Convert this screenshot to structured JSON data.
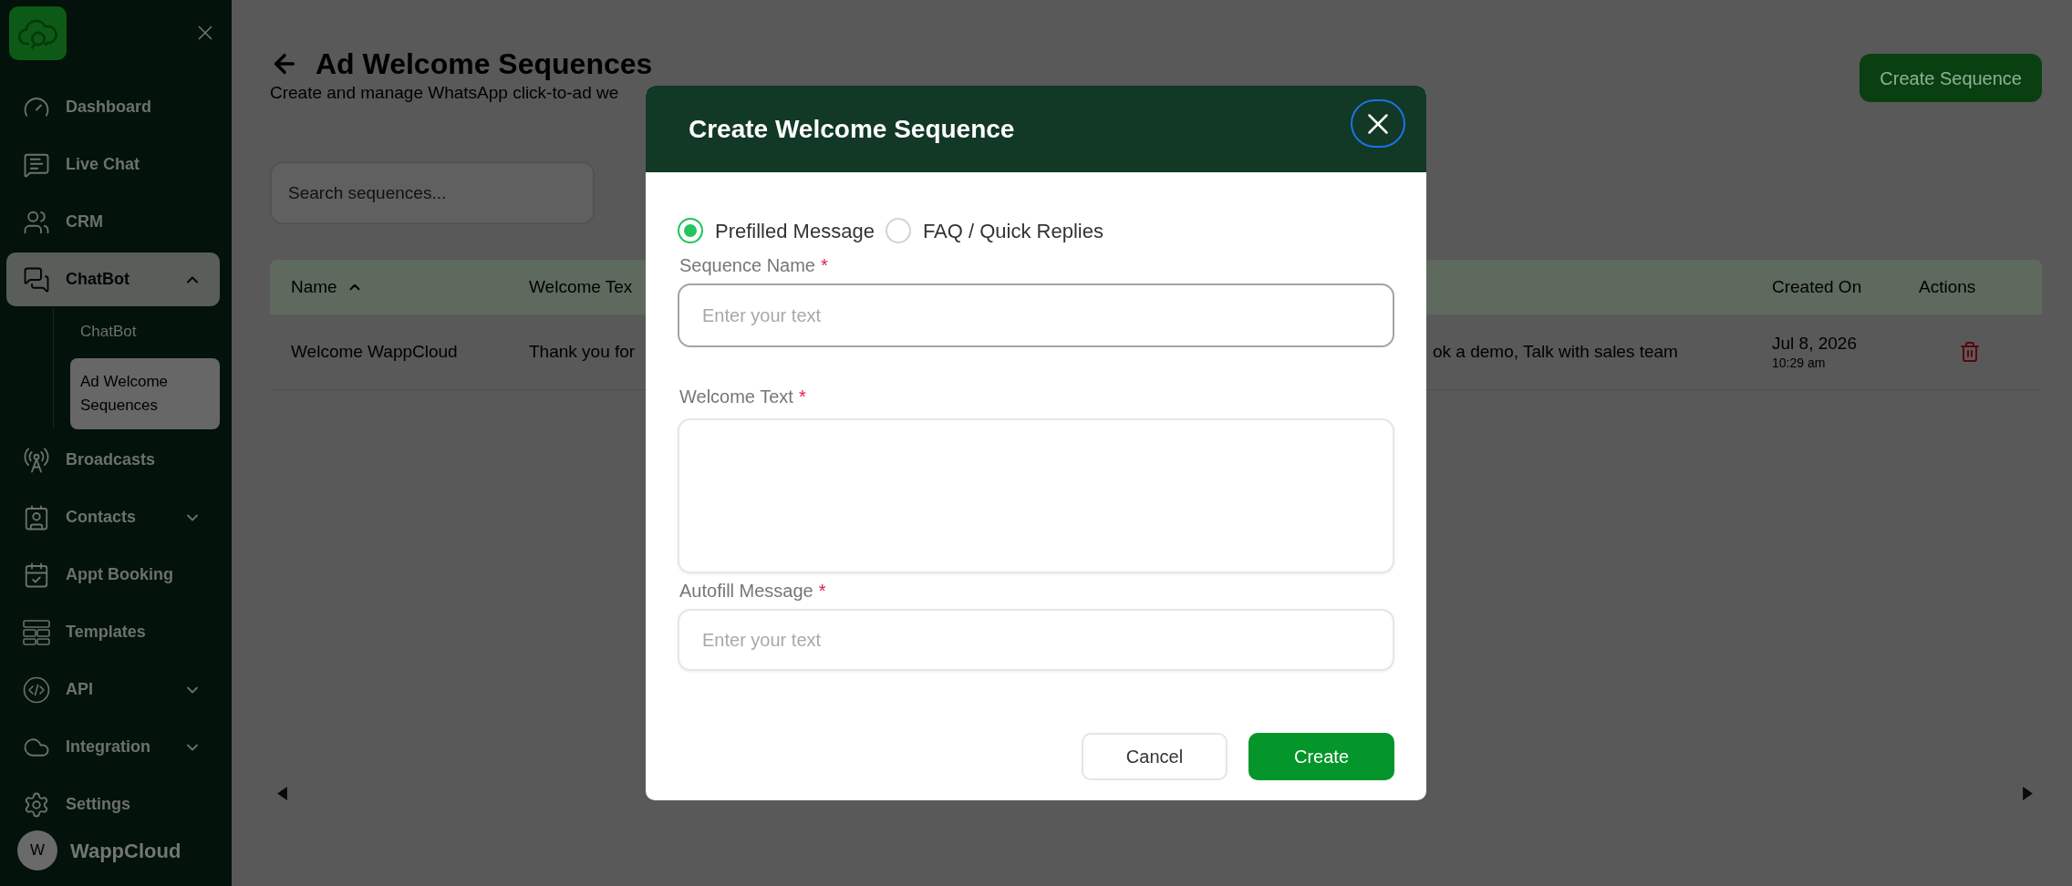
{
  "sidebar": {
    "items": [
      {
        "label": "Dashboard",
        "selected": false
      },
      {
        "label": "Live Chat",
        "selected": false
      },
      {
        "label": "CRM",
        "selected": false
      },
      {
        "label": "ChatBot",
        "selected": true,
        "expanded": true,
        "children": [
          {
            "label": "ChatBot",
            "selected": false
          },
          {
            "label": "Ad Welcome Sequences",
            "selected": true
          }
        ]
      },
      {
        "label": "Broadcasts",
        "selected": false
      },
      {
        "label": "Contacts",
        "selected": false,
        "expanded": false
      },
      {
        "label": "Appt Booking",
        "selected": false
      },
      {
        "label": "Templates",
        "selected": false
      },
      {
        "label": "API",
        "selected": false,
        "expanded": false
      },
      {
        "label": "Integration",
        "selected": false,
        "expanded": false
      },
      {
        "label": "Settings",
        "selected": false
      }
    ],
    "user": {
      "initial": "W",
      "name": "WappCloud"
    }
  },
  "page": {
    "title": "Ad Welcome Sequences",
    "subtitle": "Create and manage WhatsApp click-to-ad we",
    "create_button": "Create Sequence",
    "search": {
      "placeholder": "Search sequences..."
    }
  },
  "table": {
    "columns": [
      {
        "label": "Name",
        "sort_ascending": true
      },
      {
        "label": "Welcome Tex"
      },
      {
        "label": "Created On"
      },
      {
        "label": "Actions"
      }
    ],
    "rows": [
      {
        "name": "Welcome WappCloud",
        "welcome_text": "Thank you for",
        "column_3": "ok a demo, Talk with sales team",
        "created_date": "Jul 8, 2026",
        "created_time": "10:29 am"
      }
    ]
  },
  "dialog": {
    "title": "Create Welcome Sequence",
    "close_button": {
      "focused": true
    },
    "options": [
      {
        "label": "Prefilled Message",
        "selected": true
      },
      {
        "label": "FAQ / Quick Replies",
        "selected": false
      }
    ],
    "fields": [
      {
        "kind": "input",
        "label": "Sequence Name",
        "required_mark": "*",
        "placeholder": "Enter your text",
        "focused": true
      },
      {
        "kind": "textarea",
        "label": "Welcome Text",
        "required_mark": "*",
        "focused": false
      },
      {
        "kind": "input",
        "label": "Autofill Message",
        "required_mark": "*",
        "placeholder": "Enter your text",
        "focused": false
      }
    ],
    "buttons": [
      {
        "kind": "secondary",
        "label": "Cancel"
      },
      {
        "kind": "primary",
        "label": "Create"
      }
    ]
  }
}
